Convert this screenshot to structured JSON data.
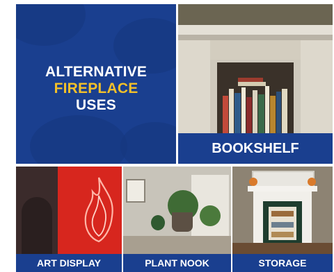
{
  "title": {
    "line1": "ALTERNATIVE",
    "line2": "FIREPLACE",
    "line3": "USES"
  },
  "panels": {
    "bookshelf": {
      "caption": "BOOKSHELF"
    },
    "art_display": {
      "caption": "ART DISPLAY"
    },
    "plant_nook": {
      "caption": "PLANT NOOK"
    },
    "storage": {
      "caption": "STORAGE"
    }
  },
  "colors": {
    "brand_blue": "#1a3f8f",
    "highlight_yellow": "#f2c02a",
    "neon_red": "#ff3b2f"
  },
  "icons": [
    "neon-flame-icon"
  ]
}
